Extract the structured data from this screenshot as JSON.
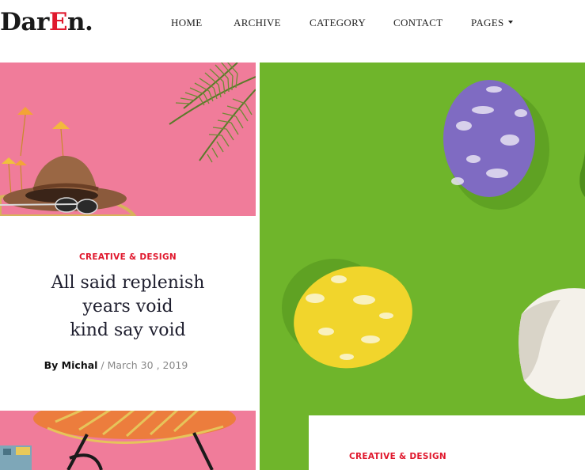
{
  "brand": {
    "logo_part1": "Dar",
    "logo_part2": "E",
    "logo_part3": "n."
  },
  "nav": [
    {
      "label": "HOME"
    },
    {
      "label": "ARCHIVE"
    },
    {
      "label": "CATEGORY"
    },
    {
      "label": "CONTACT"
    },
    {
      "label": "PAGES"
    }
  ],
  "posts": [
    {
      "category": "CREATIVE & DESIGN",
      "title_lines": [
        "All said replenish",
        "years void",
        "kind say void"
      ],
      "author": "By Michal",
      "date_sep": " / ",
      "date": "March 30 , 2019",
      "image_icon": "pink-hat-photo"
    },
    {
      "category": "CREATIVE & DESIGN",
      "image_icon": "easter-eggs-photo"
    },
    {
      "image_icon": "pink-chair-photo"
    }
  ],
  "colors": {
    "accent": "#e0182d",
    "pink_bg": "#f07c9a",
    "green_bg": "#6fb52b",
    "title_text": "#1e1e2e",
    "meta_text": "#888888"
  }
}
